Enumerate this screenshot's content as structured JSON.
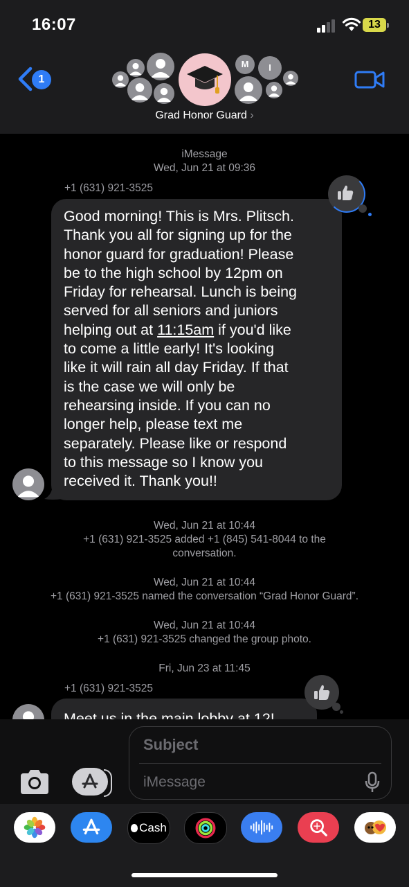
{
  "status": {
    "time": "16:07",
    "battery": "13"
  },
  "header": {
    "back_badge": "1",
    "group_name": "Grad Honor Guard",
    "group_name_chevron": "›",
    "member_initials": [
      "M",
      "I"
    ]
  },
  "conversation": {
    "service": "iMessage",
    "first_timestamp": "Wed, Jun 21 at 09:36",
    "message1": {
      "sender": "+1 (631) 921-3525",
      "lines": [
        "Good morning! This is Mrs. Plitsch.",
        "Thank you all for signing up for the",
        "honor guard for graduation! Please",
        "be to the high school by 12pm on",
        "Friday for rehearsal. Lunch is being",
        "served for all seniors and juniors",
        "helping out at ",
        "11:15am",
        " if you'd like",
        "to come a little early! It's looking",
        "like it will rain all day Friday. If that",
        "is the case we will only be",
        "rehearsing inside. If you can no",
        "longer help, please text me",
        "separately. Please like or respond",
        "to this message so I know you",
        "received it. Thank you!!"
      ]
    },
    "events": [
      {
        "time": "Wed, Jun 21 at 10:44",
        "text_line1": "+1 (631) 921-3525 added +1 (845) 541-8044 to the",
        "text_line2": "conversation."
      },
      {
        "time": "Wed, Jun 21 at 10:44",
        "text_line1": "+1 (631) 921-3525 named the conversation “Grad Honor Guard”."
      },
      {
        "time": "Wed, Jun 21 at 10:44",
        "text_line1": "+1 (631) 921-3525 changed the group photo."
      }
    ],
    "second_timestamp": "Fri, Jun 23 at 11:45",
    "message2": {
      "sender": "+1 (631) 921-3525",
      "text": "Meet us in the main lobby at 12!"
    }
  },
  "composer": {
    "subject_placeholder": "Subject",
    "message_placeholder": "iMessage"
  },
  "app_strip": {
    "cash_label": "Cash",
    "apps": [
      "photos-app",
      "app-store-app",
      "apple-cash-app",
      "fitness-app",
      "audio-message-app",
      "search-images-app",
      "memoji-app"
    ]
  },
  "colors": {
    "accent": "#2f7cf6",
    "bubble": "#262628",
    "group_photo": "#f3c6cc",
    "battery": "#d8d84a"
  }
}
